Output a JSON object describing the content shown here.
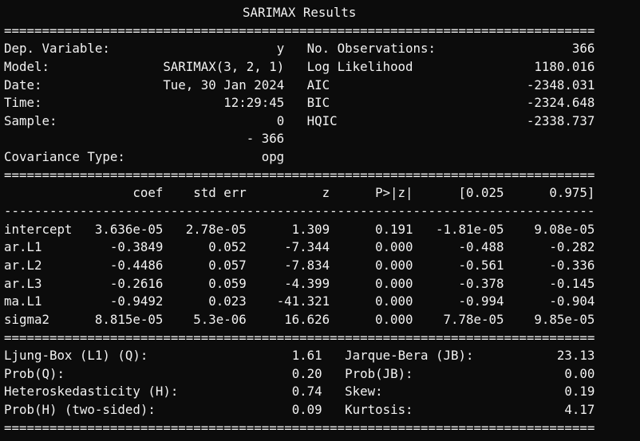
{
  "title": "SARIMAX Results",
  "separator_double": "==============================================================================",
  "separator_single": "------------------------------------------------------------------------------",
  "model_info": [
    {
      "label": "Dep. Variable:",
      "value": "y",
      "label2": "No. Observations:",
      "value2": "366"
    },
    {
      "label": "Model:",
      "value": "SARIMAX(3, 2, 1)",
      "label2": "Log Likelihood",
      "value2": "1180.016"
    },
    {
      "label": "Date:",
      "value": "Tue, 30 Jan 2024",
      "label2": "AIC",
      "value2": "-2348.031"
    },
    {
      "label": "Time:",
      "value": "12:29:45",
      "label2": "BIC",
      "value2": "-2324.648"
    },
    {
      "label": "Sample:",
      "value": "0",
      "label2": "HQIC",
      "value2": "-2338.737"
    },
    {
      "label": "",
      "value": "- 366",
      "label2": "",
      "value2": ""
    },
    {
      "label": "Covariance Type:",
      "value": "opg",
      "label2": "",
      "value2": ""
    }
  ],
  "params": {
    "headers": [
      "",
      "coef",
      "std err",
      "z",
      "P>|z|",
      "[0.025",
      "0.975]"
    ],
    "rows": [
      [
        "intercept",
        "3.636e-05",
        "2.78e-05",
        "1.309",
        "0.191",
        "-1.81e-05",
        "9.08e-05"
      ],
      [
        "ar.L1",
        "-0.3849",
        "0.052",
        "-7.344",
        "0.000",
        "-0.488",
        "-0.282"
      ],
      [
        "ar.L2",
        "-0.4486",
        "0.057",
        "-7.834",
        "0.000",
        "-0.561",
        "-0.336"
      ],
      [
        "ar.L3",
        "-0.2616",
        "0.059",
        "-4.399",
        "0.000",
        "-0.378",
        "-0.145"
      ],
      [
        "ma.L1",
        "-0.9492",
        "0.023",
        "-41.321",
        "0.000",
        "-0.994",
        "-0.904"
      ],
      [
        "sigma2",
        "8.815e-05",
        "5.3e-06",
        "16.626",
        "0.000",
        "7.78e-05",
        "9.85e-05"
      ]
    ]
  },
  "diagnostics": [
    {
      "label": "Ljung-Box (L1) (Q):",
      "value": "1.61",
      "label2": "Jarque-Bera (JB):",
      "value2": "23.13"
    },
    {
      "label": "Prob(Q):",
      "value": "0.20",
      "label2": "Prob(JB):",
      "value2": "0.00"
    },
    {
      "label": "Heteroskedasticity (H):",
      "value": "0.74",
      "label2": "Skew:",
      "value2": "0.19"
    },
    {
      "label": "Prob(H) (two-sided):",
      "value": "0.09",
      "label2": "Kurtosis:",
      "value2": "4.17"
    }
  ],
  "colors": {
    "background": "#0c0c0c",
    "text": "#f2f2f2"
  }
}
